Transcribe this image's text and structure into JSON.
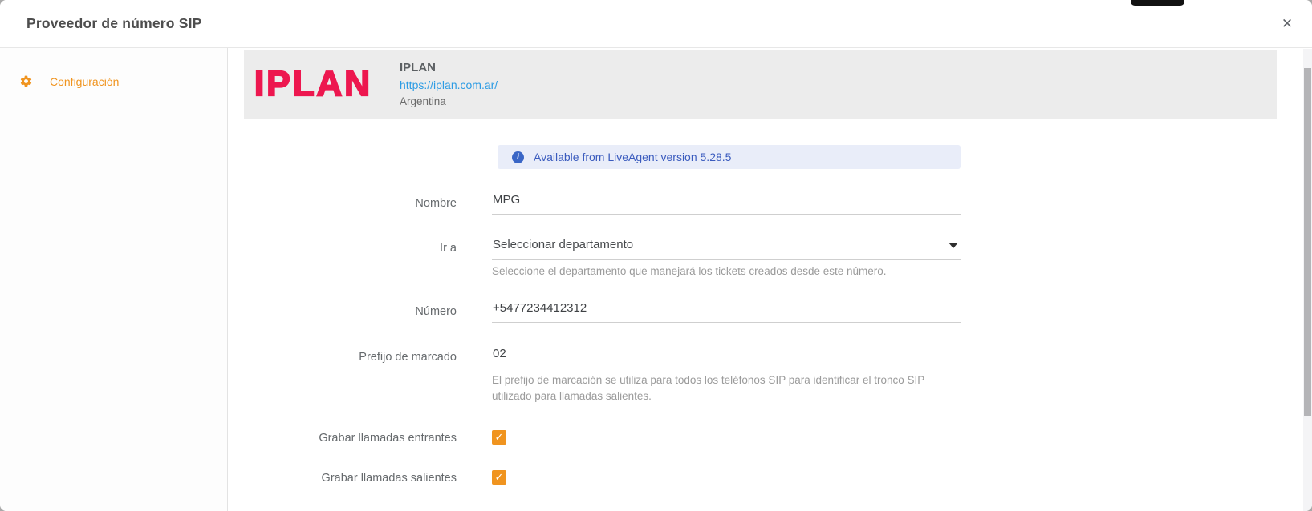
{
  "dialog": {
    "title": "Proveedor de número SIP",
    "close_label": "✕"
  },
  "sidebar": {
    "items": [
      {
        "label": "Configuración",
        "icon": "gear-icon",
        "active": true
      }
    ]
  },
  "provider": {
    "logo_text": "IPLAN",
    "name": "IPLAN",
    "url": "https://iplan.com.ar/",
    "country": "Argentina",
    "logo_color": "#ed174f"
  },
  "alert": {
    "icon": "info-icon",
    "icon_glyph": "i",
    "text": "Available from LiveAgent version 5.28.5",
    "background": "#e9edf9",
    "text_color": "#3a5bbe"
  },
  "form": {
    "fields": [
      {
        "label": "Nombre",
        "type": "text",
        "value": "MPG"
      },
      {
        "label": "Ir a",
        "type": "select",
        "value": "Seleccionar departamento",
        "helper": "Seleccione el departamento que manejará los tickets creados desde este número."
      },
      {
        "label": "Número",
        "type": "text",
        "value": "+5477234412312"
      },
      {
        "label": "Prefijo de marcado",
        "type": "text",
        "value": "02",
        "helper": "El prefijo de marcación se utiliza para todos los teléfonos SIP para identificar el tronco SIP utilizado para llamadas salientes."
      },
      {
        "label": "Grabar llamadas entrantes",
        "type": "checkbox",
        "checked": true,
        "check_glyph": "✓"
      },
      {
        "label": "Grabar llamadas salientes",
        "type": "checkbox",
        "checked": true,
        "check_glyph": "✓"
      }
    ]
  },
  "colors": {
    "accent_orange": "#f0941f",
    "link_blue": "#2d9ce4",
    "banner_gray": "#ececec",
    "underline": "#cfcfcf"
  }
}
